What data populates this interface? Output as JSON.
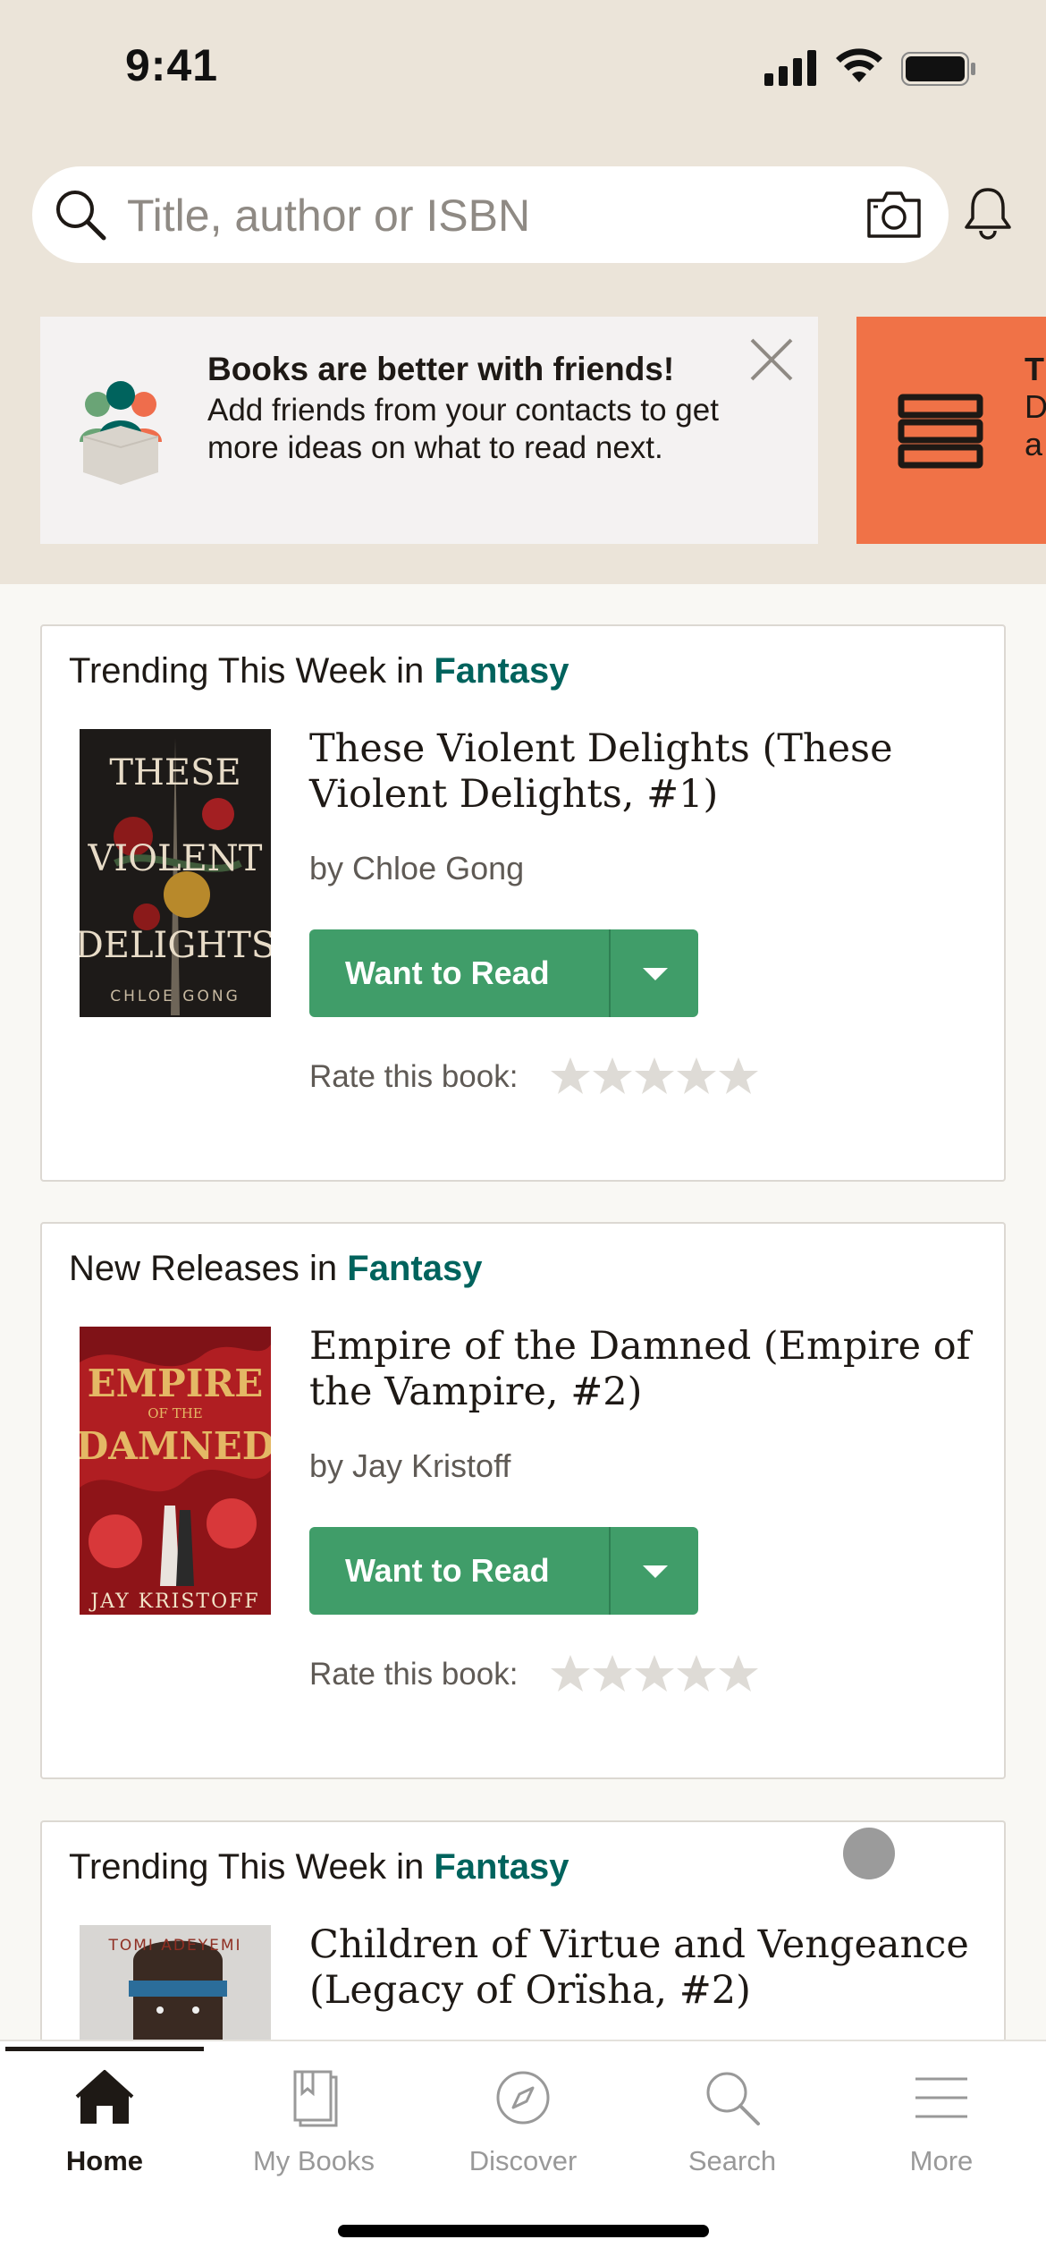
{
  "status_bar": {
    "time": "9:41"
  },
  "search": {
    "placeholder": "Title, author or ISBN"
  },
  "promos": [
    {
      "title": "Books are better with friends!",
      "body": "Add friends from your contacts to get more ideas on what to read next."
    },
    {
      "title_partial": "T",
      "body_partial": "D\na"
    }
  ],
  "cards": [
    {
      "heading_prefix": "Trending This Week in",
      "genre": "Fantasy",
      "book_title": "These Violent Delights (These Violent Delights, #1)",
      "author": "by Chloe Gong",
      "cover_lines": [
        "THESE",
        "VIOLENT",
        "DELIGHTS"
      ],
      "cover_author": "CHLOE GONG",
      "button_label": "Want to Read",
      "rate_label": "Rate this book:",
      "rating": 0
    },
    {
      "heading_prefix": "New Releases in",
      "genre": "Fantasy",
      "book_title": "Empire of the Damned (Empire of the Vampire, #2)",
      "author": "by Jay Kristoff",
      "cover_lines": [
        "EMPIRE",
        "OF THE",
        "DAMNED"
      ],
      "cover_author": "JAY KRISTOFF",
      "button_label": "Want to Read",
      "rate_label": "Rate this book:",
      "rating": 0
    },
    {
      "heading_prefix": "Trending This Week in",
      "genre": "Fantasy",
      "book_title": "Children of Virtue and Vengeance (Legacy of Orïsha, #2)",
      "cover_author": "TOMI ADEYEMI"
    }
  ],
  "tabs": [
    {
      "label": "Home",
      "icon": "home-icon",
      "active": true
    },
    {
      "label": "My Books",
      "icon": "bookmark-book-icon",
      "active": false
    },
    {
      "label": "Discover",
      "icon": "compass-icon",
      "active": false
    },
    {
      "label": "Search",
      "icon": "search-icon",
      "active": false
    },
    {
      "label": "More",
      "icon": "menu-icon",
      "active": false
    }
  ],
  "colors": {
    "header_bg": "#ebe4d9",
    "accent_green": "#409d69",
    "genre_teal": "#00635d",
    "promo_orange": "#f07247"
  }
}
